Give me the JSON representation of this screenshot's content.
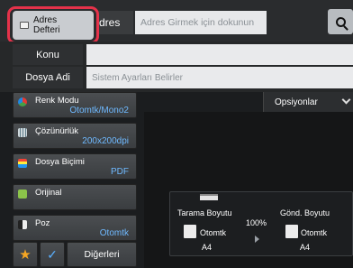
{
  "colors": {
    "accent_value": "#6fb9ff",
    "highlight_ring": "#e5324a",
    "favorite_star": "#f5a623",
    "check": "#5ab0ff"
  },
  "address": {
    "book_button_label_line1": "Adres",
    "book_button_label_line2": "Defteri",
    "tab_label": "dres",
    "input_placeholder": "Adres Girmek için dokunun",
    "search_icon": "search-icon"
  },
  "subject": {
    "label": "Konu",
    "value": ""
  },
  "file_name": {
    "label": "Dosya Adi",
    "placeholder": "Sistem Ayarları Belirler"
  },
  "settings": [
    {
      "label": "Renk Modu",
      "value": "Otomtk/Mono2",
      "icon": "color-mode-icon"
    },
    {
      "label": "Çözünürlük",
      "value": "200x200dpi",
      "icon": "resolution-icon"
    },
    {
      "label": "Dosya Biçimi",
      "value": "PDF",
      "icon": "file-format-icon"
    },
    {
      "label": "Orijinal",
      "value": "",
      "icon": "original-icon"
    },
    {
      "label": "Poz",
      "value": "Otomtk",
      "icon": "exposure-icon"
    }
  ],
  "bottom": {
    "others_label": "Diğerleri"
  },
  "options": {
    "label": "Opsiyonlar"
  },
  "scan_info": {
    "scan_size_label": "Tarama Boyutu",
    "scan_size_mode": "Otomtk",
    "scan_size_paper": "A4",
    "ratio": "100%",
    "send_size_label": "Gönd. Boyutu",
    "send_size_mode": "Otomtk",
    "send_size_paper": "A4"
  }
}
